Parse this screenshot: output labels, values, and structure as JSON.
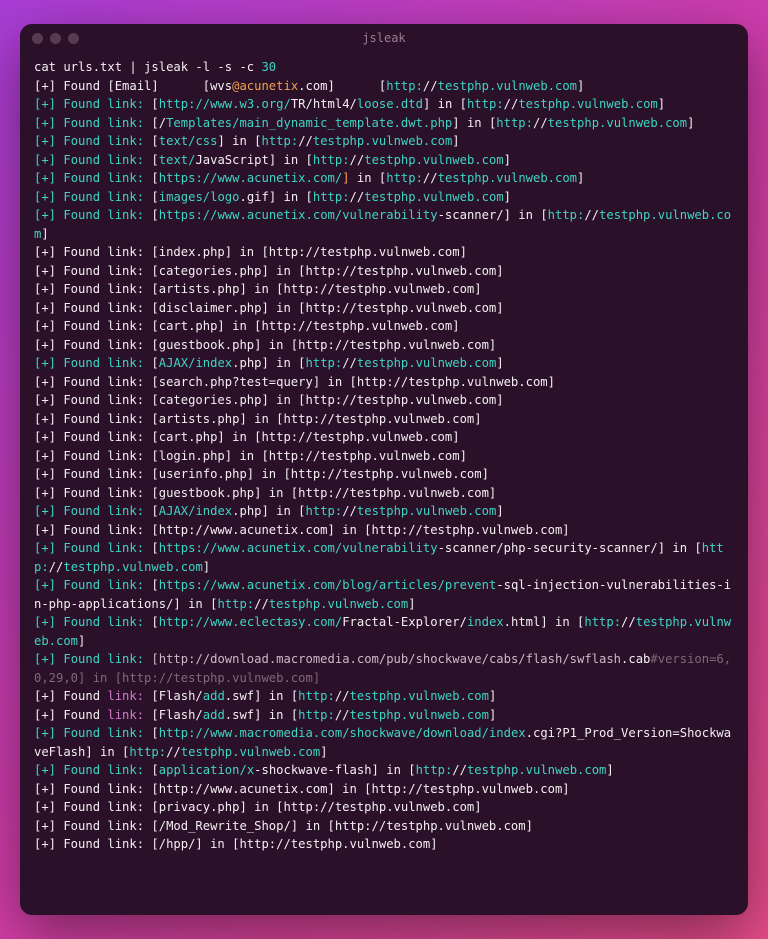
{
  "window": {
    "title": "jsleak"
  },
  "cmd": {
    "p1": "cat urls.txt | jsleak -l -s -c ",
    "p2": "30"
  },
  "lines": [
    [
      [
        "w",
        "[+] Found [Email]      [wvs"
      ],
      [
        "o",
        "@acunetix"
      ],
      [
        "w",
        ".com]      ["
      ],
      [
        "c",
        "http:"
      ],
      [
        "w",
        "//"
      ],
      [
        "c",
        "testphp.vulnweb.com"
      ],
      [
        "w",
        "]"
      ]
    ],
    [
      [
        "c",
        "[+]"
      ],
      [
        "w",
        " "
      ],
      [
        "c",
        "Found link:"
      ],
      [
        "w",
        " ["
      ],
      [
        "c",
        "http://www.w3.org/"
      ],
      [
        "w",
        "TR/html4/"
      ],
      [
        "c",
        "loose.dtd"
      ],
      [
        "w",
        "] in ["
      ],
      [
        "c",
        "http:"
      ],
      [
        "w",
        "//"
      ],
      [
        "c",
        "testphp.vulnweb.com"
      ],
      [
        "w",
        "]"
      ]
    ],
    [
      [
        "c",
        "[+]"
      ],
      [
        "w",
        " "
      ],
      [
        "c",
        "Found link:"
      ],
      [
        "w",
        " [/"
      ],
      [
        "c",
        "Templates/main_dynamic_template.dwt.php"
      ],
      [
        "w",
        "] in ["
      ],
      [
        "c",
        "http:"
      ],
      [
        "w",
        "//"
      ],
      [
        "c",
        "testphp.vulnweb.com"
      ],
      [
        "w",
        "]"
      ]
    ],
    [
      [
        "c",
        "[+]"
      ],
      [
        "w",
        " "
      ],
      [
        "c",
        "Found link:"
      ],
      [
        "w",
        " ["
      ],
      [
        "c",
        "text/css"
      ],
      [
        "w",
        "] in ["
      ],
      [
        "c",
        "http:"
      ],
      [
        "w",
        "//"
      ],
      [
        "c",
        "testphp.vulnweb.com"
      ],
      [
        "w",
        "]"
      ]
    ],
    [
      [
        "c",
        "[+]"
      ],
      [
        "w",
        " "
      ],
      [
        "c",
        "Found link:"
      ],
      [
        "w",
        " ["
      ],
      [
        "c",
        "text/"
      ],
      [
        "w",
        "JavaScript] in ["
      ],
      [
        "c",
        "http:"
      ],
      [
        "w",
        "//"
      ],
      [
        "c",
        "testphp.vulnweb.com"
      ],
      [
        "w",
        "]"
      ]
    ],
    [
      [
        "c",
        "[+]"
      ],
      [
        "w",
        " "
      ],
      [
        "c",
        "Found link:"
      ],
      [
        "w",
        " ["
      ],
      [
        "c",
        "https://www.acunetix.com/"
      ],
      [
        "o",
        "]"
      ],
      [
        "w",
        " in ["
      ],
      [
        "c",
        "http:"
      ],
      [
        "w",
        "//"
      ],
      [
        "c",
        "testphp.vulnweb.com"
      ],
      [
        "w",
        "]"
      ]
    ],
    [
      [
        "c",
        "[+]"
      ],
      [
        "w",
        " "
      ],
      [
        "c",
        "Found link:"
      ],
      [
        "w",
        " ["
      ],
      [
        "c",
        "images/logo"
      ],
      [
        "w",
        ".gif] in ["
      ],
      [
        "c",
        "http:"
      ],
      [
        "w",
        "//"
      ],
      [
        "c",
        "testphp.vulnweb.com"
      ],
      [
        "w",
        "]"
      ]
    ],
    [
      [
        "c",
        "[+]"
      ],
      [
        "w",
        " "
      ],
      [
        "c",
        "Found link:"
      ],
      [
        "w",
        " ["
      ],
      [
        "c",
        "https://www.acunetix.com/vulnerability"
      ],
      [
        "w",
        "-scanner/] in ["
      ],
      [
        "c",
        "http:"
      ],
      [
        "w",
        "//"
      ],
      [
        "c",
        "testphp.vulnweb.com"
      ],
      [
        "w",
        "]"
      ]
    ],
    [
      [
        "w",
        "[+] Found link: [index.php] in [http://testphp.vulnweb.com]"
      ]
    ],
    [
      [
        "w",
        "[+] Found link: [categories.php] in [http://testphp.vulnweb.com]"
      ]
    ],
    [
      [
        "w",
        "[+] Found link: [artists.php] in [http://testphp.vulnweb.com]"
      ]
    ],
    [
      [
        "w",
        "[+] Found link: [disclaimer.php] in [http://testphp.vulnweb.com]"
      ]
    ],
    [
      [
        "w",
        "[+] Found link: [cart.php] in [http://testphp.vulnweb.com]"
      ]
    ],
    [
      [
        "w",
        "[+] Found link: [guestbook.php] in [http://testphp.vulnweb.com]"
      ]
    ],
    [
      [
        "c",
        "[+]"
      ],
      [
        "w",
        " "
      ],
      [
        "c",
        "Found link:"
      ],
      [
        "w",
        " ["
      ],
      [
        "c",
        "AJAX/index"
      ],
      [
        "w",
        ".php] in ["
      ],
      [
        "c",
        "http:"
      ],
      [
        "w",
        "//"
      ],
      [
        "c",
        "testphp.vulnweb.com"
      ],
      [
        "w",
        "]"
      ]
    ],
    [
      [
        "w",
        "[+] Found link: [search.php?test=query] in [http://testphp.vulnweb.com]"
      ]
    ],
    [
      [
        "w",
        "[+] Found link: [categories.php] in [http://testphp.vulnweb.com]"
      ]
    ],
    [
      [
        "w",
        "[+] Found link: [artists.php] in [http://testphp.vulnweb.com]"
      ]
    ],
    [
      [
        "w",
        "[+] Found link: [cart.php] in [http://testphp.vulnweb.com]"
      ]
    ],
    [
      [
        "w",
        "[+] Found link: [login.php] in [http://testphp.vulnweb.com]"
      ]
    ],
    [
      [
        "w",
        "[+] Found link: [userinfo.php] in [http://testphp.vulnweb.com]"
      ]
    ],
    [
      [
        "w",
        "[+] Found link: [guestbook.php] in [http://testphp.vulnweb.com]"
      ]
    ],
    [
      [
        "c",
        "[+]"
      ],
      [
        "w",
        " "
      ],
      [
        "c",
        "Found link:"
      ],
      [
        "w",
        " ["
      ],
      [
        "c",
        "AJAX/index"
      ],
      [
        "w",
        ".php] in ["
      ],
      [
        "c",
        "http:"
      ],
      [
        "w",
        "//"
      ],
      [
        "c",
        "testphp.vulnweb.com"
      ],
      [
        "w",
        "]"
      ]
    ],
    [
      [
        "w",
        "[+] Found link: [http://www.acunetix.com] in [http://testphp.vulnweb.com]"
      ]
    ],
    [
      [
        "c",
        "[+]"
      ],
      [
        "w",
        " "
      ],
      [
        "c",
        "Found link:"
      ],
      [
        "w",
        " ["
      ],
      [
        "c",
        "https://www.acunetix.com/vulnerability"
      ],
      [
        "w",
        "-scanner/php-security-scanner/] in ["
      ],
      [
        "c",
        "http:"
      ],
      [
        "w",
        "//"
      ],
      [
        "c",
        "testphp.vulnweb.com"
      ],
      [
        "w",
        "]"
      ]
    ],
    [
      [
        "c",
        "[+]"
      ],
      [
        "w",
        " "
      ],
      [
        "c",
        "Found link:"
      ],
      [
        "w",
        " ["
      ],
      [
        "c",
        "https://www.acunetix.com/blog/articles/prevent"
      ],
      [
        "w",
        "-sql-injection-vulnerabilities-in-php-applications/] in ["
      ],
      [
        "c",
        "http:"
      ],
      [
        "w",
        "//"
      ],
      [
        "c",
        "testphp.vulnweb.com"
      ],
      [
        "w",
        "]"
      ]
    ],
    [
      [
        "c",
        "[+]"
      ],
      [
        "w",
        " "
      ],
      [
        "c",
        "Found link:"
      ],
      [
        "w",
        " ["
      ],
      [
        "c",
        "http://www.eclectasy.com/"
      ],
      [
        "w",
        "Fractal-Explorer/"
      ],
      [
        "c",
        "index"
      ],
      [
        "w",
        ".html] in ["
      ],
      [
        "c",
        "http:"
      ],
      [
        "w",
        "//"
      ],
      [
        "c",
        "testphp.vulnweb.com"
      ],
      [
        "w",
        "]"
      ]
    ],
    [
      [
        "c",
        "[+]"
      ],
      [
        "w",
        " "
      ],
      [
        "c",
        "Found link:"
      ],
      [
        "w",
        " "
      ],
      [
        "g",
        "[http://download.macromedia.com/pub/shockwave/cabs/flash/swflash"
      ],
      [
        "w",
        ".cab"
      ],
      [
        "d",
        "#version=6,0,29,0] in [http://testphp.vulnweb.com]"
      ]
    ],
    [
      [
        "w",
        "[+] Found "
      ],
      [
        "m",
        "link:"
      ],
      [
        "w",
        " [Flash/"
      ],
      [
        "c",
        "add"
      ],
      [
        "w",
        ".swf] in ["
      ],
      [
        "c",
        "http:"
      ],
      [
        "w",
        "//"
      ],
      [
        "c",
        "testphp.vulnweb.com"
      ],
      [
        "w",
        "]"
      ]
    ],
    [
      [
        "w",
        "[+] Found "
      ],
      [
        "m",
        "link:"
      ],
      [
        "w",
        " [Flash/"
      ],
      [
        "c",
        "add"
      ],
      [
        "w",
        ".swf] in ["
      ],
      [
        "c",
        "http:"
      ],
      [
        "w",
        "//"
      ],
      [
        "c",
        "testphp.vulnweb.com"
      ],
      [
        "w",
        "]"
      ]
    ],
    [
      [
        "c",
        "[+]"
      ],
      [
        "w",
        " "
      ],
      [
        "c",
        "Found link:"
      ],
      [
        "w",
        " ["
      ],
      [
        "c",
        "http://www.macromedia.com/shockwave/download/index"
      ],
      [
        "w",
        ".cgi?P1_Prod_Version=ShockwaveFlash] in ["
      ],
      [
        "c",
        "http:"
      ],
      [
        "w",
        "//"
      ],
      [
        "c",
        "testphp.vulnweb.com"
      ],
      [
        "w",
        "]"
      ]
    ],
    [
      [
        "c",
        "[+]"
      ],
      [
        "w",
        " "
      ],
      [
        "c",
        "Found link:"
      ],
      [
        "w",
        " ["
      ],
      [
        "c",
        "application/x"
      ],
      [
        "w",
        "-shockwave-flash] in ["
      ],
      [
        "c",
        "http:"
      ],
      [
        "w",
        "//"
      ],
      [
        "c",
        "testphp.vulnweb.com"
      ],
      [
        "w",
        "]"
      ]
    ],
    [
      [
        "w",
        "[+] Found link: [http://www.acunetix.com] in [http://testphp.vulnweb.com]"
      ]
    ],
    [
      [
        "w",
        "[+] Found link: [privacy.php] in [http://testphp.vulnweb.com]"
      ]
    ],
    [
      [
        "w",
        "[+] Found link: [/Mod_Rewrite_Shop/] in [http://testphp.vulnweb.com]"
      ]
    ],
    [
      [
        "w",
        "[+] Found link: [/hpp/] in [http://testphp.vulnweb.com]"
      ]
    ]
  ]
}
